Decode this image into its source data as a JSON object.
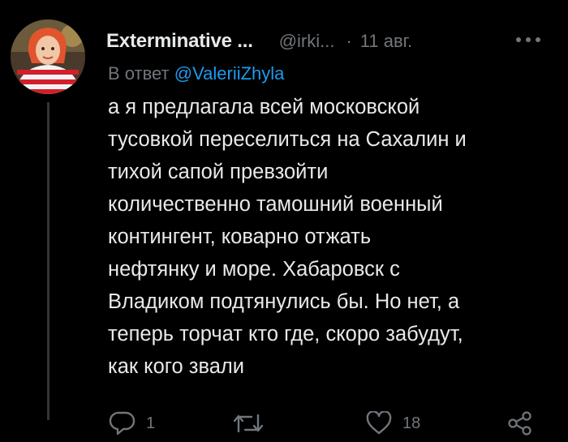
{
  "tweet": {
    "author_name": "Exterminative ...",
    "handle": "@irki...",
    "separator": "·",
    "date": "11 авг.",
    "reply_prefix": "В ответ",
    "reply_to": "@ValeriiZhyla",
    "body_lines": [
      "а я предлагала всей московской",
      "тусовкой переселиться на Сахалин и",
      "тихой сапой превзойти",
      "количественно тамошний военный",
      "контингент, коварно отжать",
      "нефтянку и море. Хабаровск с",
      "Владиком подтянулись бы. Но нет, а",
      "теперь торчат кто где, скоро забудут,",
      "как кого звали"
    ]
  },
  "actions": {
    "reply_count": "1",
    "retweet_count": "",
    "like_count": "18"
  },
  "icons": {
    "more": "more-icon",
    "reply": "reply-icon",
    "retweet": "retweet-icon",
    "like": "heart-icon",
    "share": "share-icon"
  },
  "colors": {
    "background": "#000000",
    "text": "#e7e9ea",
    "muted": "#71767b",
    "link": "#1d9bf0"
  }
}
